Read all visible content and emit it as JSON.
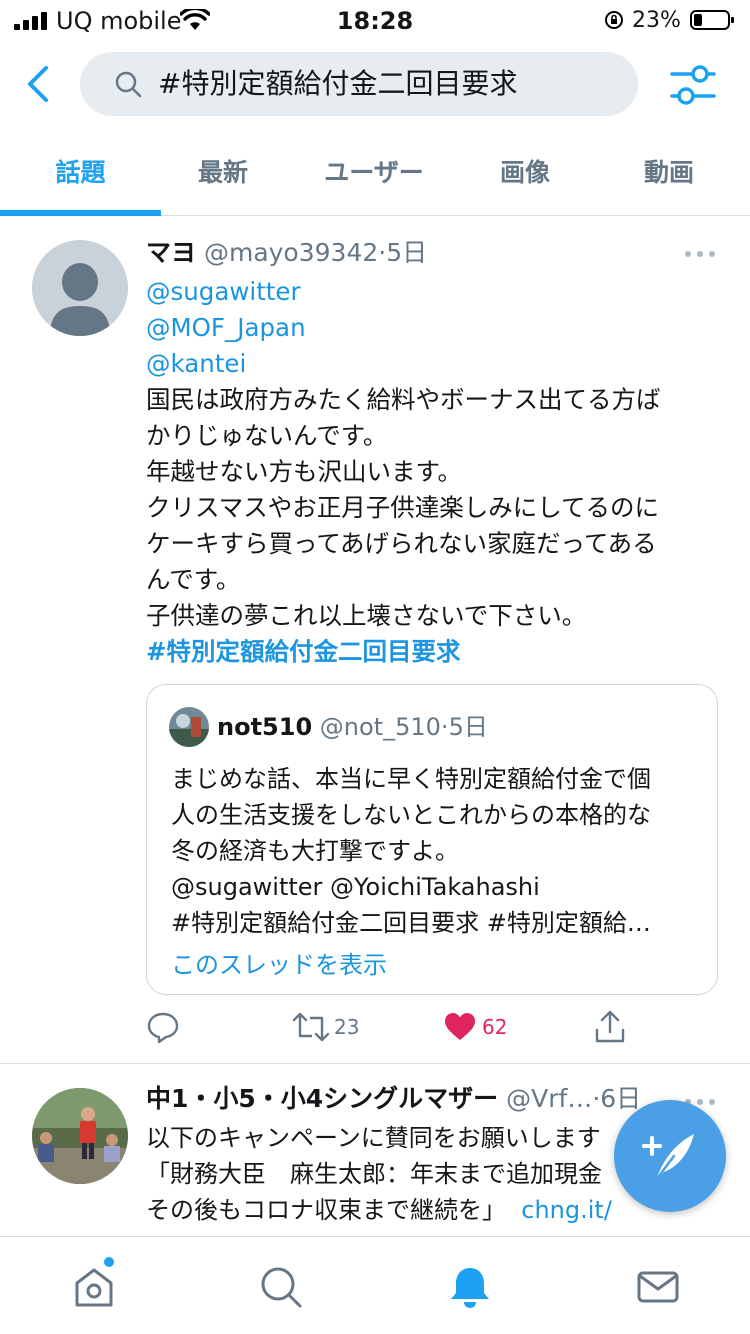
{
  "status_bar": {
    "carrier": "UQ mobile",
    "time": "18:28",
    "battery_percent": "23%",
    "icons": [
      "signal-icon",
      "wifi-icon",
      "rotation-lock-icon",
      "battery-icon"
    ]
  },
  "search": {
    "query": "#特別定額給付金二回目要求",
    "icons": [
      "back-chevron-icon",
      "search-icon",
      "filter-sliders-icon"
    ]
  },
  "tabs": [
    {
      "label": "話題",
      "active": true
    },
    {
      "label": "最新",
      "active": false
    },
    {
      "label": "ユーザー",
      "active": false
    },
    {
      "label": "画像",
      "active": false
    },
    {
      "label": "動画",
      "active": false
    }
  ],
  "tweet1": {
    "name": "マヨ",
    "handle": "@mayo39342",
    "dot": "·",
    "time": "5日",
    "lines": [
      "@sugawitter",
      "@MOF_Japan",
      "@kantei",
      "国民は政府方みたく給料やボーナス出てる方ば",
      "かりじゅないんです。",
      "年越せない方も沢山います。",
      "クリスマスやお正月子供達楽しみにしてるのに",
      "ケーキすら買ってあげられない家庭だってある",
      "んです。",
      "子供達の夢これ以上壊さないで下さい。",
      "#特別定額給付金二回目要求"
    ],
    "quote": {
      "name": "not510",
      "handle": "@not_510",
      "dot": "·",
      "time": "5日",
      "lines": [
        "まじめな話、本当に早く特別定額給付金で個",
        "人の生活支援をしないとこれからの本格的な",
        "冬の経済も大打撃ですよ。",
        "@sugawitter @YoichiTakahashi",
        "#特別定額給付金二回目要求 #特別定額給…"
      ],
      "show_thread": "このスレッドを表示"
    },
    "actions": {
      "retweets": "23",
      "likes": "62",
      "liked": true,
      "like_color": "#e0245e"
    }
  },
  "tweet2": {
    "name": "中1・小5・小4シングルマザー",
    "handle": "@Vrf…",
    "dot": "·",
    "time": "6日",
    "lines": [
      "以下のキャンペーンに賛同をお願いします",
      "「財務大臣　麻生太郎：年末まで追加現金",
      "その後もコロナ収束まで継続を」"
    ],
    "link": "chng.it/"
  },
  "colors": {
    "accent": "#1da1f2",
    "link": "#1b95e0",
    "muted": "#657786",
    "fab": "#4a9fe6"
  },
  "bottom_nav": [
    "home-icon",
    "search-icon",
    "notifications-bell-icon",
    "messages-envelope-icon"
  ]
}
